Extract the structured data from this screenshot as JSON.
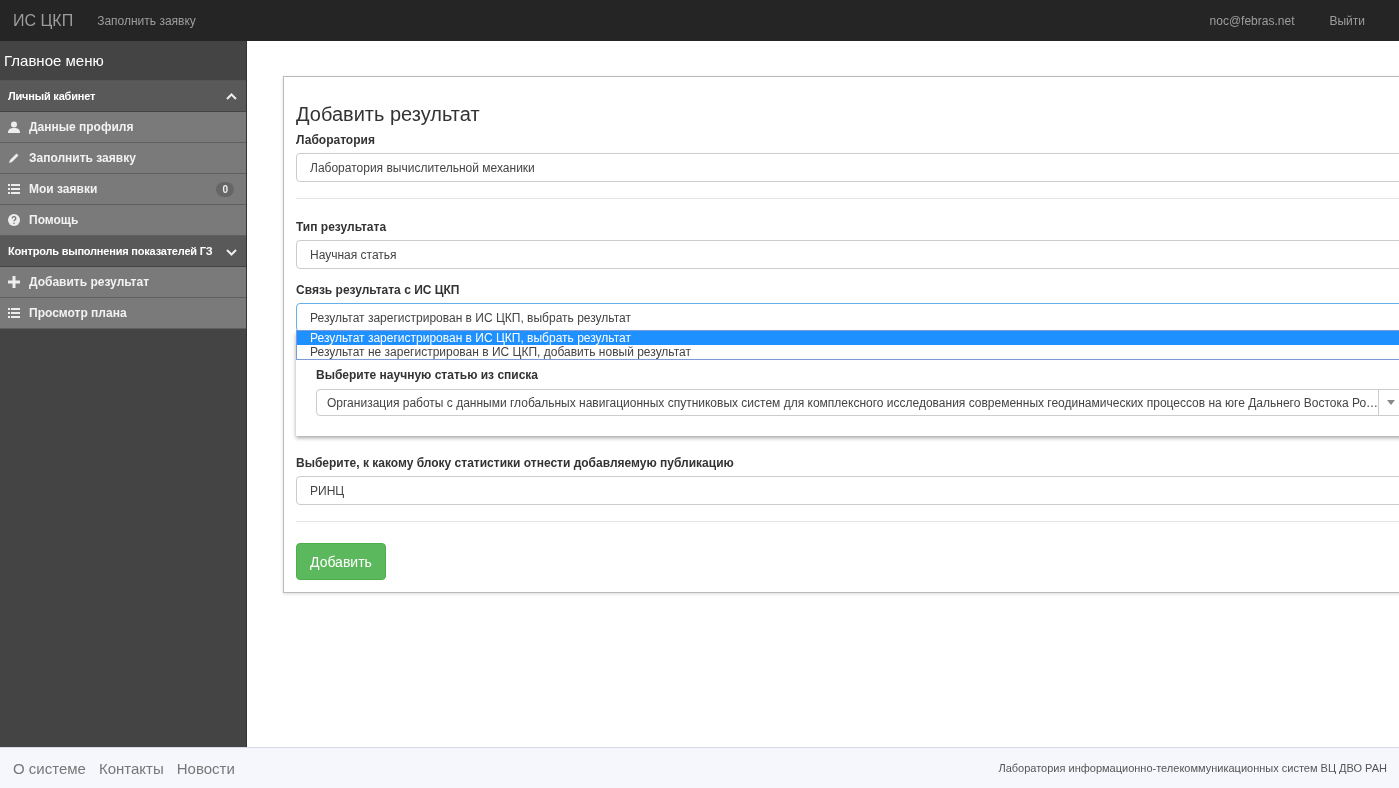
{
  "navbar": {
    "brand": "ИС ЦКП",
    "links": [
      "Заполнить заявку"
    ],
    "user": "noc@febras.net",
    "logout": "Выйти"
  },
  "sidebar": {
    "title": "Главное меню",
    "groups": [
      {
        "label": "Личный кабинет",
        "expanded": true,
        "items": [
          {
            "label": "Данные профиля",
            "kind": "user"
          },
          {
            "label": "Заполнить заявку",
            "kind": "pencil"
          },
          {
            "label": "Мои заявки",
            "kind": "list",
            "badge": "0"
          },
          {
            "label": "Помощь",
            "kind": "question"
          }
        ]
      },
      {
        "label": "Контроль выполнения показателей ГЗ",
        "expanded": false,
        "items": [
          {
            "label": "Добавить результат",
            "kind": "plus"
          },
          {
            "label": "Просмотр плана",
            "kind": "list"
          }
        ]
      }
    ]
  },
  "form": {
    "title": "Добавить результат",
    "laboratory": {
      "label": "Лаборатория",
      "value": "Лаборатория вычислительной механики"
    },
    "result_type": {
      "label": "Тип результата",
      "value": "Научная статья"
    },
    "link": {
      "label": "Связь результата с ИС ЦКП",
      "value": "Результат зарегистрирован в ИС ЦКП, выбрать результат",
      "expanded": true,
      "options": [
        {
          "label": "Результат зарегистрирован в ИС ЦКП, выбрать результат",
          "selected": true
        },
        {
          "label": "Результат не зарегистрирован в ИС ЦКП, добавить новый результат",
          "selected": false
        }
      ]
    },
    "article": {
      "label": "Выберите научную статью из списка",
      "value": "Организация работы с данными глобальных навигационных спутниковых систем для комплексного исследования современных геодинамических процессов на юге Дальнего Востока Ро…"
    },
    "stat_block": {
      "label": "Выберите, к какому блоку статистики отнести добавляемую публикацию",
      "value": "РИНЦ"
    },
    "submit": "Добавить"
  },
  "footer": {
    "links": [
      "О системе",
      "Контакты",
      "Новости"
    ],
    "credit": "Лаборатория информационно-телекоммуникационных систем ВЦ ДВО РАН"
  }
}
